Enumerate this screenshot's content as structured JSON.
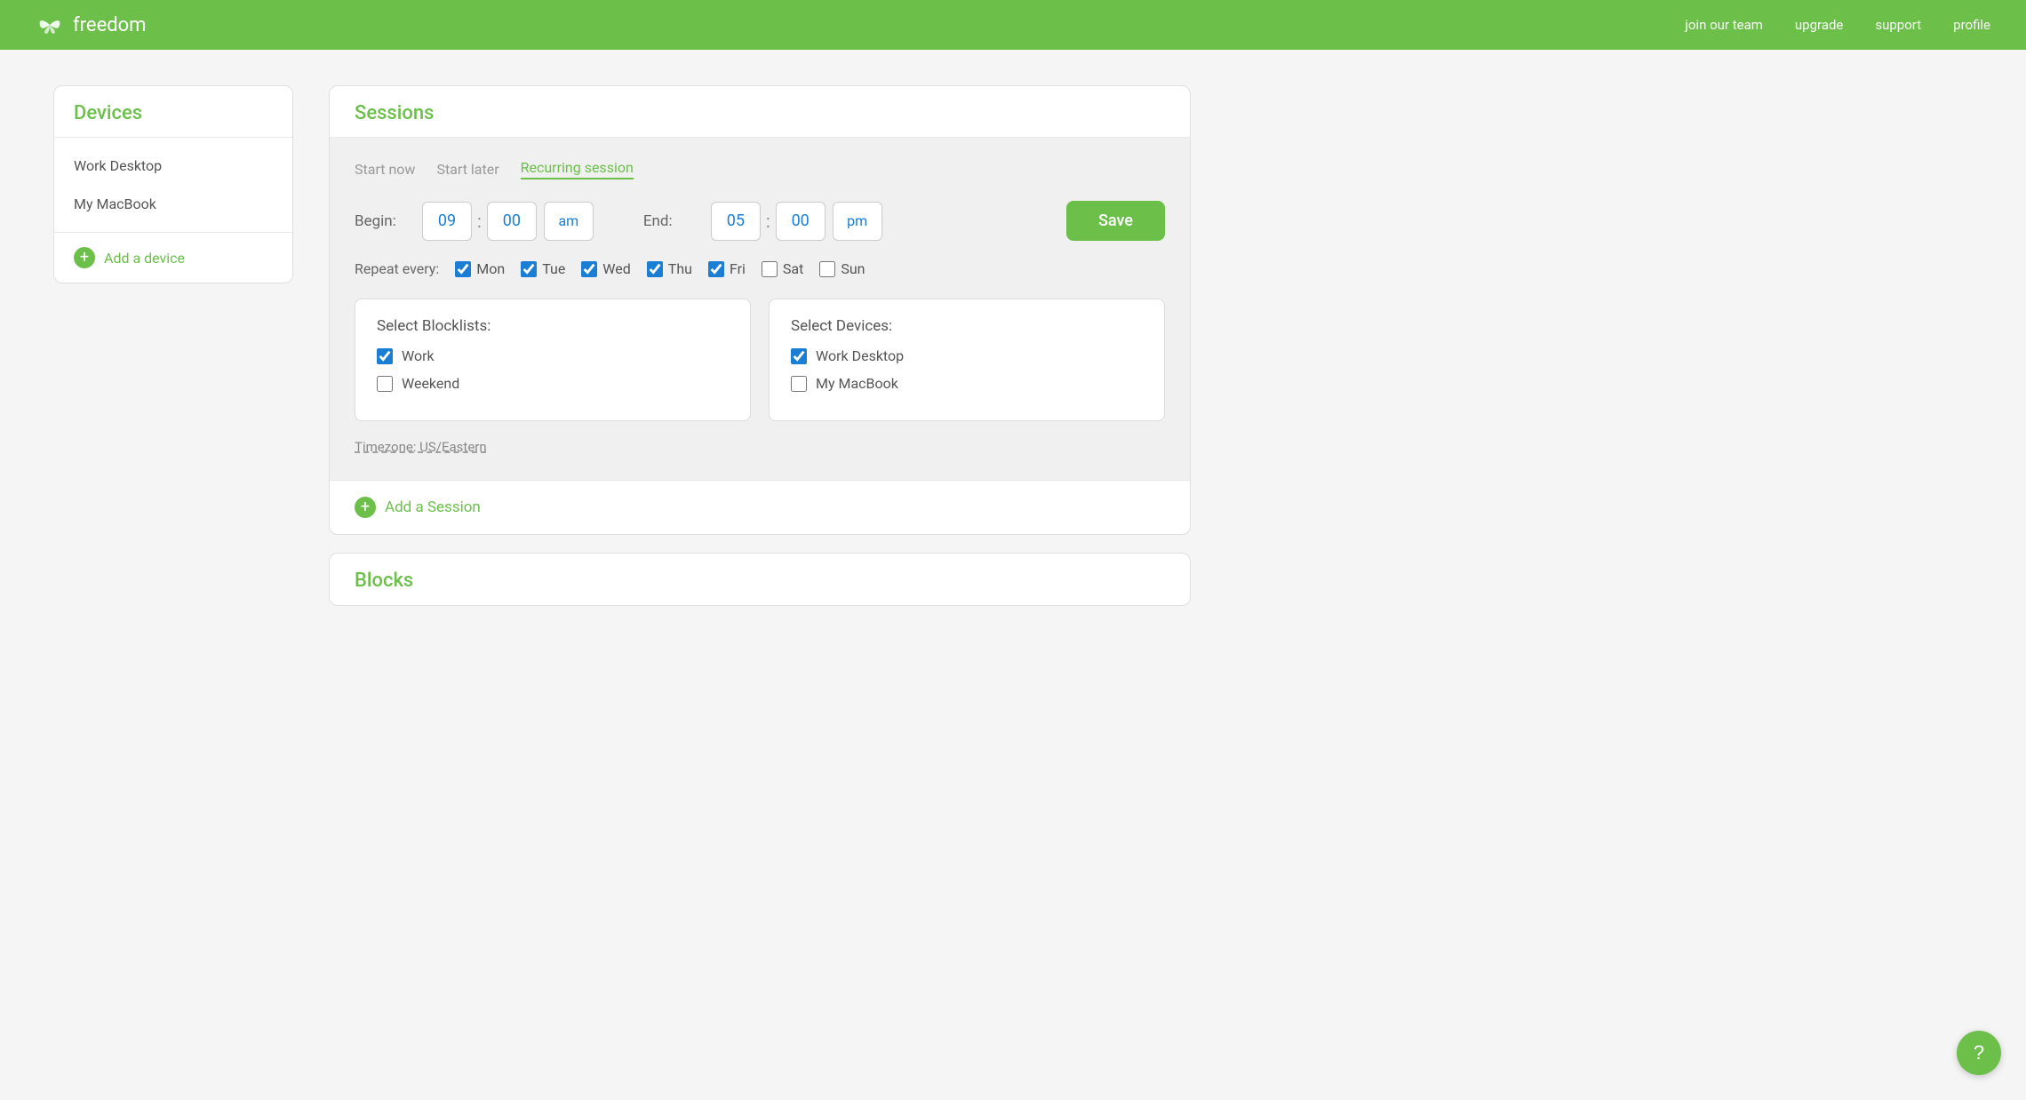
{
  "header": {
    "logo_text": "freedom",
    "nav": {
      "join": "join our team",
      "upgrade": "upgrade",
      "support": "support",
      "profile": "profile"
    }
  },
  "sidebar": {
    "title": "Devices",
    "devices": [
      {
        "name": "Work Desktop"
      },
      {
        "name": "My MacBook"
      }
    ],
    "add_label": "Add a device"
  },
  "sessions": {
    "title": "Sessions",
    "tabs": [
      {
        "label": "Start now",
        "id": "start-now",
        "active": false
      },
      {
        "label": "Start later",
        "id": "start-later",
        "active": false
      },
      {
        "label": "Recurring session",
        "id": "recurring",
        "active": true
      }
    ],
    "begin_label": "Begin:",
    "end_label": "End:",
    "begin_hour": "09",
    "begin_min": "00",
    "begin_ampm": "am",
    "end_hour": "05",
    "end_min": "00",
    "end_ampm": "pm",
    "save_label": "Save",
    "repeat_label": "Repeat every:",
    "days": [
      {
        "label": "Mon",
        "checked": true
      },
      {
        "label": "Tue",
        "checked": true
      },
      {
        "label": "Wed",
        "checked": true
      },
      {
        "label": "Thu",
        "checked": true
      },
      {
        "label": "Fri",
        "checked": true
      },
      {
        "label": "Sat",
        "checked": false
      },
      {
        "label": "Sun",
        "checked": false
      }
    ],
    "blocklists_title": "Select Blocklists:",
    "blocklists": [
      {
        "label": "Work",
        "checked": true
      },
      {
        "label": "Weekend",
        "checked": false
      }
    ],
    "devices_title": "Select Devices:",
    "devices": [
      {
        "label": "Work Desktop",
        "checked": true
      },
      {
        "label": "My MacBook",
        "checked": false
      }
    ],
    "timezone": "Timezone: US/Eastern",
    "add_session_label": "Add a Session"
  },
  "blocks": {
    "title": "Blocks"
  },
  "help": "?"
}
